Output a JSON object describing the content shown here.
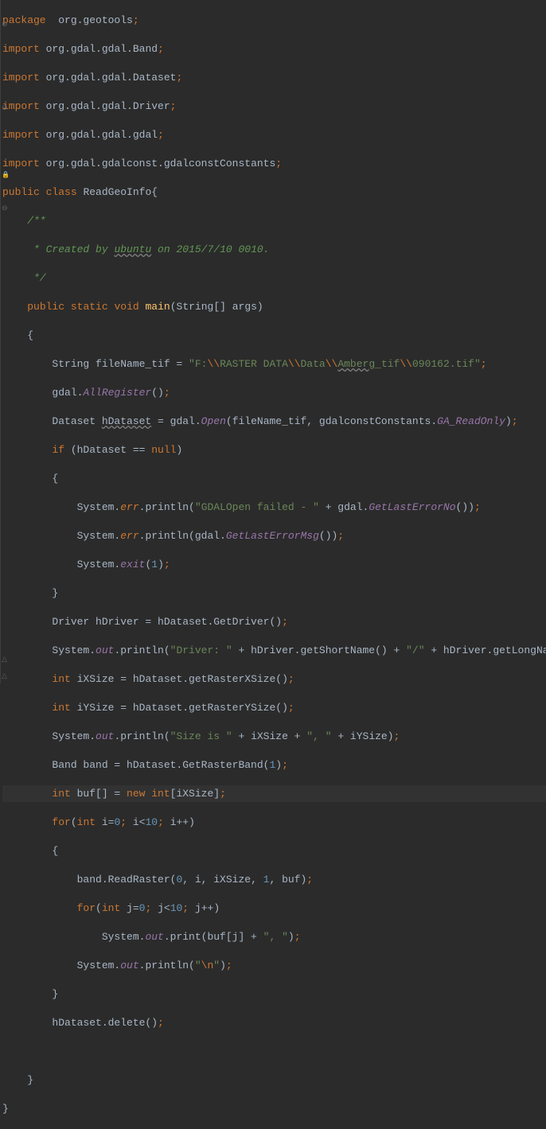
{
  "code": {
    "l1": {
      "package": "package",
      "pkg": "org.geotools",
      "semi": ";"
    },
    "l2": {
      "import": "import",
      "pkg": "org.gdal.gdal.Band",
      "semi": ";"
    },
    "l3": {
      "import": "import",
      "pkg": "org.gdal.gdal.Dataset",
      "semi": ";"
    },
    "l4": {
      "import": "import",
      "pkg": "org.gdal.gdal.Driver",
      "semi": ";"
    },
    "l5": {
      "import": "import",
      "pkg": "org.gdal.gdal.gdal",
      "semi": ";"
    },
    "l6": {
      "import": "import",
      "pkg": "org.gdal.gdalconst.gdalconstConstants",
      "semi": ";"
    },
    "l7": {
      "public": "public",
      "class": "class",
      "name": "ReadGeoInfo",
      "brace": "{"
    },
    "l8": {
      "cmt": "    /**"
    },
    "l9": {
      "cmt1": "     * Created by ",
      "ubuntu": "ubuntu",
      "cmt2": " on 2015/7/10 0010."
    },
    "l10": {
      "cmt": "     */"
    },
    "l11": {
      "indent": "    ",
      "public": "public",
      "static": "static",
      "void": "void",
      "main": "main",
      "paren": "(String[] args)"
    },
    "l12": {
      "txt": "    {"
    },
    "l13": {
      "indent": "        String fileName_tif = ",
      "q1": "\"F:",
      "esc1": "\\\\",
      "s2": "RASTER DATA",
      "esc2": "\\\\",
      "s3": "Data",
      "esc3": "\\\\",
      "amberg": "Amberg",
      "s4": "_tif",
      "esc4": "\\\\",
      "s5": "090162.tif\"",
      "semi": ";"
    },
    "l14": {
      "indent": "        gdal.",
      "mtd": "AllRegister",
      "paren": "()",
      "semi": ";"
    },
    "l15": {
      "indent": "        Dataset ",
      "var": "hDataset",
      "eq": " = gdal.",
      "open": "Open",
      "paren": "(fileName_tif, gdalconstConstants.",
      "ro": "GA_ReadOnly",
      "close": ")",
      "semi": ";"
    },
    "l16": {
      "indent": "        ",
      "if": "if",
      "paren": " (hDataset == ",
      "null": "null",
      "close": ")"
    },
    "l17": {
      "txt": "        {"
    },
    "l18": {
      "indent": "            System.",
      "err": "err",
      "dot": ".println(",
      "str": "\"GDALOpen failed - \"",
      "plus": " + gdal.",
      "mtd": "GetLastErrorNo",
      "close": "())",
      "semi": ";"
    },
    "l19": {
      "indent": "            System.",
      "err": "err",
      "dot": ".println(gdal.",
      "mtd": "GetLastErrorMsg",
      "close": "())",
      "semi": ";"
    },
    "l20": {
      "indent": "            System.",
      "exit": "exit",
      "paren": "(",
      "num": "1",
      "close": ")",
      "semi": ";"
    },
    "l21": {
      "txt": "        }"
    },
    "l22": {
      "indent": "        Driver hDriver = hDataset.GetDriver()",
      "semi": ";"
    },
    "l23": {
      "indent": "        System.",
      "out": "out",
      "p1": ".println(",
      "str": "\"Driver: \"",
      "p2": " + hDriver.getShortName() + ",
      "str2": "\"/\"",
      "p3": " + hDriver.getLongName())",
      "semi": ";"
    },
    "l24": {
      "indent": "        ",
      "int": "int",
      "rest": " iXSize = hDataset.getRasterXSize()",
      "semi": ";"
    },
    "l25": {
      "indent": "        ",
      "int": "int",
      "rest": " iYSize = hDataset.getRasterYSize()",
      "semi": ";"
    },
    "l26": {
      "indent": "        System.",
      "out": "out",
      "p1": ".println(",
      "str": "\"Size is \"",
      "p2": " + iXSize + ",
      "str2": "\", \"",
      "p3": " + iYSize)",
      "semi": ";"
    },
    "l27": {
      "indent": "        Band band = hDataset.GetRasterBand(",
      "num": "1",
      "close": ")",
      "semi": ";"
    },
    "l28": {
      "indent": "        ",
      "int": "int",
      "var": " buf[] = ",
      "new": "new int",
      "br": "[iXSize]",
      "semi": ";"
    },
    "l29": {
      "indent": "        ",
      "for": "for",
      "p1": "(",
      "int": "int",
      "ieq": " i=",
      "z": "0",
      "semi1": ";",
      "ilt": " i<",
      "ten": "10",
      "semi2": ";",
      "inc": " i++)"
    },
    "l30": {
      "txt": "        {"
    },
    "l31": {
      "indent": "            band.ReadRaster(",
      "z1": "0",
      "c1": ", i, iXSize, ",
      "one": "1",
      "c2": ", buf)",
      "semi": ";"
    },
    "l32": {
      "indent": "            ",
      "for": "for",
      "p1": "(",
      "int": "int",
      "jeq": " j=",
      "z": "0",
      "semi1": ";",
      "jlt": " j<",
      "ten": "10",
      "semi2": ";",
      "inc": " j++)"
    },
    "l33": {
      "indent": "                System.",
      "out": "out",
      "p1": ".print(buf[j] + ",
      "str": "\", \"",
      "close": ")",
      "semi": ";"
    },
    "l34": {
      "indent": "            System.",
      "out": "out",
      "p1": ".println(",
      "str": "\"",
      "esc": "\\n",
      "q": "\"",
      "close": ")",
      "semi": ";"
    },
    "l35": {
      "txt": "        }"
    },
    "l36": {
      "indent": "        hDataset.delete()",
      "semi": ";"
    },
    "l37": {
      "txt": ""
    },
    "l38": {
      "txt": "    }"
    },
    "l39": {
      "txt": "}"
    }
  },
  "gutter": {
    "minus1": "⊖",
    "minus2": "⊖",
    "lock": "🔒",
    "minus3": "⊖",
    "up": "△"
  }
}
